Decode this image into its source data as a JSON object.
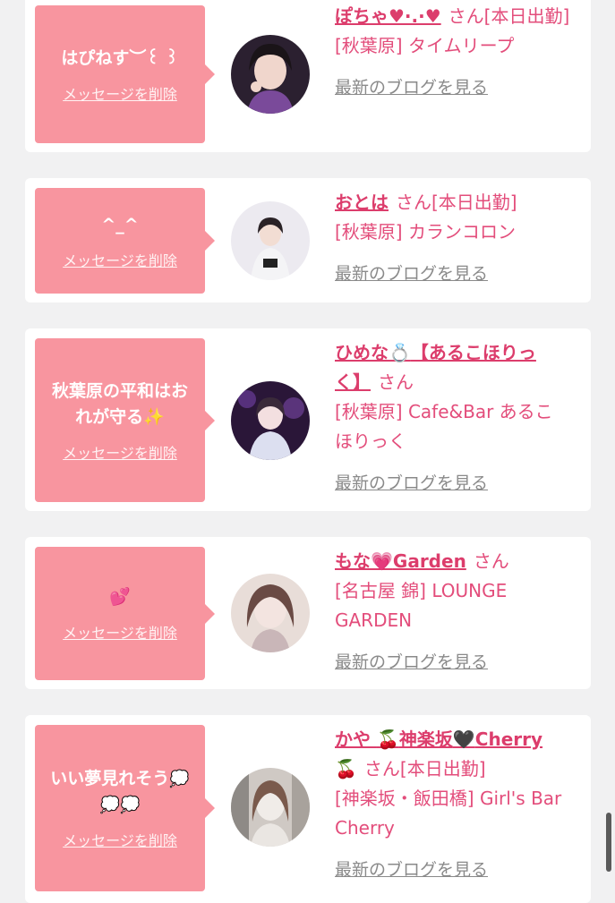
{
  "delete_label": "メッセージを削除",
  "blog_label": "最新のブログを見る",
  "san_label": "さん",
  "colors": {
    "bubble": "#f8959f",
    "accent": "#dc3d6c",
    "link_gray": "#8a8a8a",
    "background": "#f1f1f2"
  },
  "items": [
    {
      "message": "はぴねす︶꒰ ꒱",
      "name": "ぽちゃ♥︎·.·♥︎",
      "status": "[本日出勤]",
      "shop": "[秋葉原] タイムリープ"
    },
    {
      "message": "^_^",
      "name": "おとは",
      "status": "[本日出勤]",
      "shop": "[秋葉原] カランコロン"
    },
    {
      "message_line1": "秋葉原の平和はお",
      "message_line2": "れが守る",
      "message_icon": "sparkles-icon",
      "name_part1": "ひめな",
      "name_part2": "【あるこほりっ",
      "name_part3": "く】",
      "name_icon": "ring-icon",
      "status": "",
      "shop_line1": "[秋葉原] Cafe&Bar あるこ",
      "shop_line2": "ほりっく"
    },
    {
      "message_icon": "two-hearts-icon",
      "name_part1": "もな",
      "name_part2": "Garden",
      "name_icon": "pink-heart-icon",
      "status": "",
      "shop_line1": "[名古屋 錦] LOUNGE",
      "shop_line2": "GARDEN"
    },
    {
      "message_line1": "いい夢見れそう",
      "message_icon": "thought-bubble-icon",
      "name_part1": "かや",
      "name_part2": "神楽坂",
      "name_part3": "Cherry",
      "name_icon1": "cherries-icon",
      "name_icon2": "black-heart-icon",
      "status": "[本日出勤]",
      "shop_line1": "[神楽坂・飯田橋] Girl's Bar",
      "shop_line2": "Cherry"
    }
  ]
}
